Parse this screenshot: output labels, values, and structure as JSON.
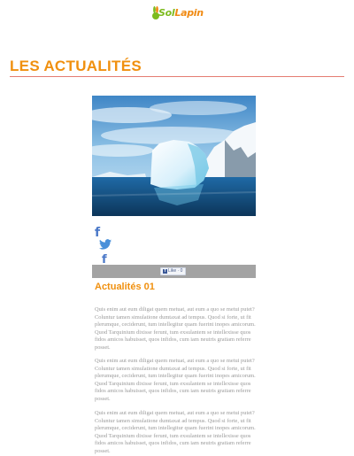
{
  "brand": {
    "logo_text_a": "Sol",
    "logo_text_b": "Lapin"
  },
  "page": {
    "title": "LES ACTUALITÉS"
  },
  "article": {
    "image_alt": "iceberg-photo",
    "share": {
      "facebook_top": "f",
      "facebook_bottom": "f"
    },
    "fb_like": {
      "label": "Like · 0"
    },
    "title": "Actualités 01",
    "paragraphs": [
      "Quis enim aut eum diligat quem metuat, aut eum a quo se metui putet? Coluntur tamen simulatione dumtaxat ad tempus. Quod si forte, ut fit plerumque, ceciderunt, tum intellegitur quam fuerint inopes amicorum. Quod Tarquinium dixisse ferunt, tum exsulantem se intellexisse quos fidos amicos habuisset, quos infidos, cum iam neutris gratiam referre posset.",
      "Quis enim aut eum diligat quem metuat, aut eum a quo se metui putet? Coluntur tamen simulatione dumtaxat ad tempus. Quod si forte, ut fit plerumque, ceciderunt, tum intellegitur quam fuerint inopes amicorum. Quod Tarquinium dixisse ferunt, tum exsulantem se intellexisse quos fidos amicos habuisset, quos infidos, cum iam neutris gratiam referre posset.",
      "Quis enim aut eum diligat quem metuat, aut eum a quo se metui putet? Coluntur tamen simulatione dumtaxat ad tempus. Quod si forte, ut fit plerumque, ceciderunt, tum intellegitur quam fuerint inopes amicorum. Quod Tarquinium dixisse ferunt, tum exsulantem se intellexisse quos fidos amicos habuisset, quos infidos, cum iam neutris gratiam referre posset."
    ]
  },
  "colors": {
    "accent": "#f0900f",
    "rule": "#e57c72",
    "share": "#4a78c8",
    "body_text": "#9a9a9a"
  }
}
